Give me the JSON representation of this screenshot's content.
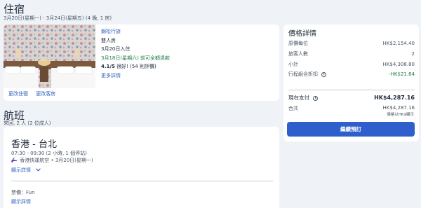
{
  "stay": {
    "title": "住宿",
    "dates": "3月20日(星期一) - 3月24日(星期五) (4 晚, 1 房)",
    "hotel": {
      "name": "錦松行旅",
      "room_type": "雙人房",
      "checkin": "3月20日入住",
      "cancellation": "3月18日(星期六) 前可全額退款",
      "rating": "4.1/5",
      "rating_word": "很好!",
      "reviews": "(54 則評價)",
      "more_details": "更多詳情"
    },
    "actions": {
      "change_stay": "更改住宿",
      "change_guests": "更改客房"
    }
  },
  "flight": {
    "title": "航班",
    "summary": "來回, 2 人 (2 位成人)",
    "route": "香港 - 台北",
    "times": "07:30 - 09:30 (2 小時, 1 個停站)",
    "airline": "香港快運航空 • 3月20日(星期一)",
    "show_details": "顯示詳情",
    "fare_label": "票價：Fun",
    "show_details_2": "顯示詳情"
  },
  "price": {
    "title": "價格詳情",
    "rows": [
      {
        "label": "原價每位",
        "value": "HK$2,154.40"
      },
      {
        "label": "旅客人數",
        "value": "2"
      },
      {
        "label": "小計",
        "value": "HK$4,308.80"
      },
      {
        "label": "行程組合折扣",
        "value": "-HK$21.64"
      }
    ],
    "now_pay_label": "現在支付",
    "now_pay_value": "HK$4,287.16",
    "total_label": "合共",
    "total_value": "HK$4,287.16",
    "total_note": "價格以HK$顯示",
    "continue_button": "繼續預訂"
  },
  "colors": {
    "accent": "#2e5fcc",
    "link": "#2f5fbf",
    "discount": "#1e7b4a",
    "background": "#eff3f8"
  }
}
